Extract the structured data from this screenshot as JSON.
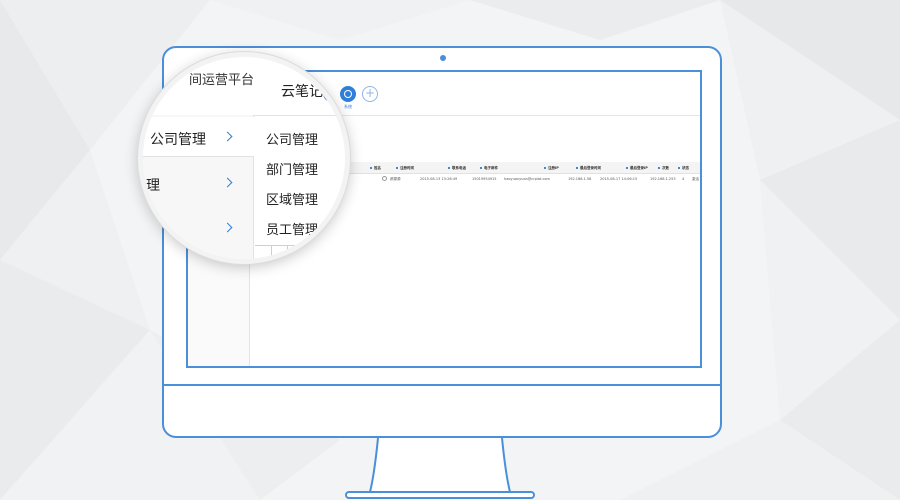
{
  "app": {
    "platform_title": "间运营平台",
    "app_name": "云笔记"
  },
  "modules": [
    {
      "label": "",
      "icon": "globe-icon"
    },
    {
      "label": "系统",
      "icon": "target-icon"
    }
  ],
  "add_module": "+",
  "sidebar": {
    "items": [
      {
        "label": "公司管理"
      },
      {
        "label": "理"
      },
      {
        "label": ""
      }
    ]
  },
  "submenu": {
    "items": [
      {
        "label": "公司管理"
      },
      {
        "label": "部门管理"
      },
      {
        "label": "区域管理"
      },
      {
        "label": "员工管理"
      }
    ]
  },
  "table": {
    "columns": [
      "姓名",
      "注册时间",
      "联系电话",
      "电子邮件",
      "注册IP",
      "最后登录时间",
      "最后登录IP",
      "次数",
      "状态"
    ],
    "rows": [
      [
        "郝源源",
        "2015-08-13 13:26:49",
        "15019954915",
        "haoyuanyuan@crplat.com",
        "192.168.1.58",
        "2015-08-17 14:06:15",
        "192.168.1.253",
        "4",
        "激活"
      ]
    ]
  },
  "colors": {
    "accent": "#2f7fd8",
    "monitor_outline": "#4a8fd9",
    "background": "#f3f4f5"
  }
}
